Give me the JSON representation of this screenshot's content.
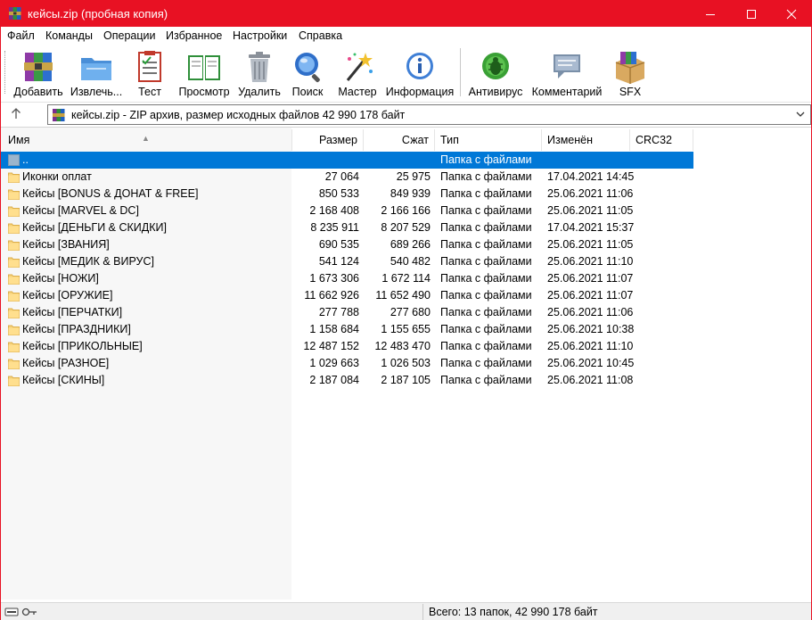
{
  "window": {
    "title": "кейсы.zip (пробная копия)",
    "accent": "#e81123",
    "selection_color": "#0078d7"
  },
  "menu": [
    "Файл",
    "Команды",
    "Операции",
    "Избранное",
    "Настройки",
    "Справка"
  ],
  "toolbar": {
    "buttons": [
      {
        "label": "Добавить",
        "icon": "add-archive-icon"
      },
      {
        "label": "Извлечь...",
        "icon": "extract-folder-icon"
      },
      {
        "label": "Тест",
        "icon": "test-checklist-icon"
      },
      {
        "label": "Просмотр",
        "icon": "view-book-icon"
      },
      {
        "label": "Удалить",
        "icon": "trash-icon"
      },
      {
        "label": "Поиск",
        "icon": "search-magnifier-icon"
      },
      {
        "label": "Мастер",
        "icon": "wizard-wand-icon"
      },
      {
        "label": "Информация",
        "icon": "info-icon"
      },
      {
        "label": "Антивирус",
        "icon": "antivirus-bug-icon"
      },
      {
        "label": "Комментарий",
        "icon": "comment-icon"
      },
      {
        "label": "SFX",
        "icon": "sfx-box-icon"
      }
    ]
  },
  "address": {
    "text": "кейсы.zip - ZIP архив, размер исходных файлов 42 990 178 байт"
  },
  "columns": {
    "name": "Имя",
    "size": "Размер",
    "packed": "Сжат",
    "type": "Тип",
    "modified": "Изменён",
    "crc": "CRC32"
  },
  "rows": [
    {
      "name": "..",
      "size": "",
      "packed": "",
      "type": "Папка с файлами",
      "modified": "",
      "selected": true,
      "parent": true
    },
    {
      "name": "Иконки оплат",
      "size": "27 064",
      "packed": "25 975",
      "type": "Папка с файлами",
      "modified": "17.04.2021 14:45"
    },
    {
      "name": "Кейсы [BONUS & ДОНАТ & FREE]",
      "size": "850 533",
      "packed": "849 939",
      "type": "Папка с файлами",
      "modified": "25.06.2021 11:06"
    },
    {
      "name": "Кейсы [MARVEL & DC]",
      "size": "2 168 408",
      "packed": "2 166 166",
      "type": "Папка с файлами",
      "modified": "25.06.2021 11:05"
    },
    {
      "name": "Кейсы [ДЕНЬГИ & СКИДКИ]",
      "size": "8 235 911",
      "packed": "8 207 529",
      "type": "Папка с файлами",
      "modified": "17.04.2021 15:37"
    },
    {
      "name": "Кейсы [ЗВАНИЯ]",
      "size": "690 535",
      "packed": "689 266",
      "type": "Папка с файлами",
      "modified": "25.06.2021 11:05"
    },
    {
      "name": "Кейсы [МЕДИК & ВИРУС]",
      "size": "541 124",
      "packed": "540 482",
      "type": "Папка с файлами",
      "modified": "25.06.2021 11:10"
    },
    {
      "name": "Кейсы [НОЖИ]",
      "size": "1 673 306",
      "packed": "1 672 114",
      "type": "Папка с файлами",
      "modified": "25.06.2021 11:07"
    },
    {
      "name": "Кейсы [ОРУЖИЕ]",
      "size": "11 662 926",
      "packed": "11 652 490",
      "type": "Папка с файлами",
      "modified": "25.06.2021 11:07"
    },
    {
      "name": "Кейсы [ПЕРЧАТКИ]",
      "size": "277 788",
      "packed": "277 680",
      "type": "Папка с файлами",
      "modified": "25.06.2021 11:06"
    },
    {
      "name": "Кейсы [ПРАЗДНИКИ]",
      "size": "1 158 684",
      "packed": "1 155 655",
      "type": "Папка с файлами",
      "modified": "25.06.2021 10:38"
    },
    {
      "name": "Кейсы [ПРИКОЛЬНЫЕ]",
      "size": "12 487 152",
      "packed": "12 483 470",
      "type": "Папка с файлами",
      "modified": "25.06.2021 11:10"
    },
    {
      "name": "Кейсы [РАЗНОЕ]",
      "size": "1 029 663",
      "packed": "1 026 503",
      "type": "Папка с файлами",
      "modified": "25.06.2021 10:45"
    },
    {
      "name": "Кейсы [СКИНЫ]",
      "size": "2 187 084",
      "packed": "2 187 105",
      "type": "Папка с файлами",
      "modified": "25.06.2021 11:08"
    }
  ],
  "status": {
    "text": "Всего: 13 папок, 42 990 178 байт"
  }
}
